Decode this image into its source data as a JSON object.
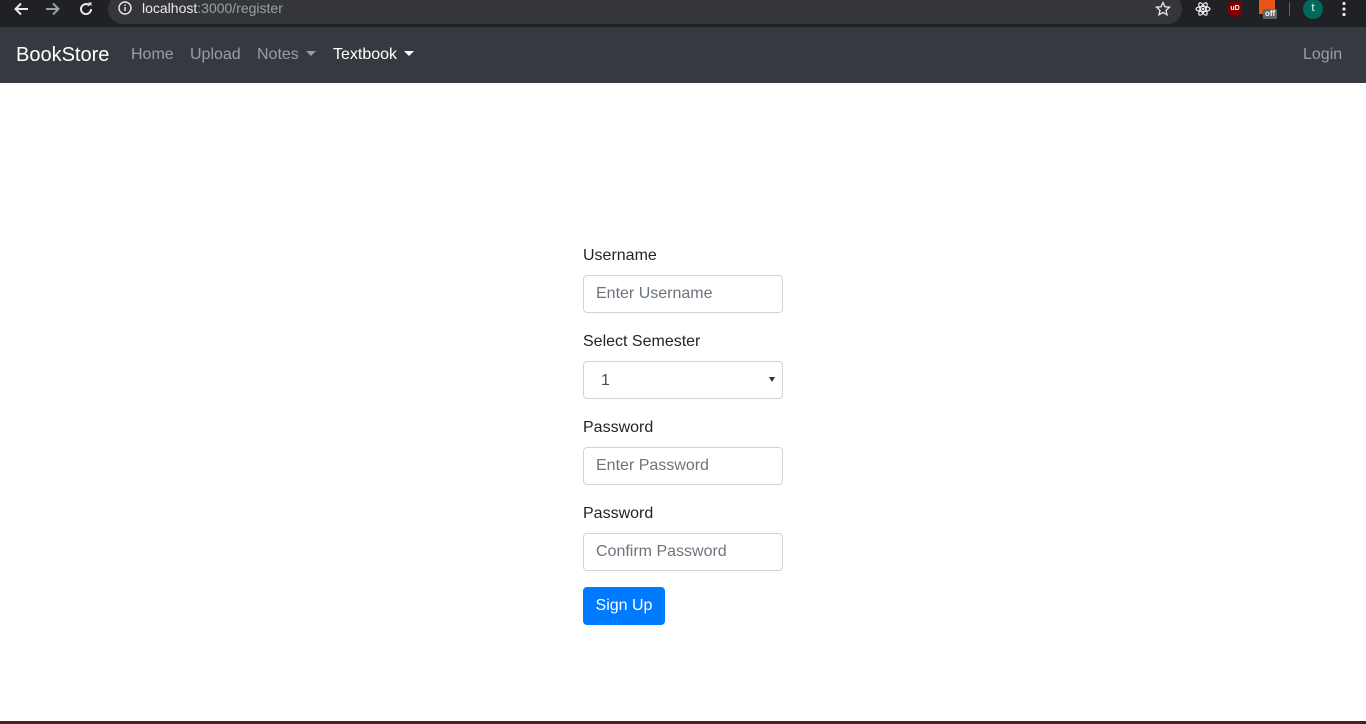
{
  "browser": {
    "url_host": "localhost",
    "url_path": ":3000/register",
    "icons": [
      "back-arrow-icon",
      "forward-arrow-icon",
      "reload-icon",
      "info-icon",
      "star-icon",
      "react-devtools-icon",
      "ublock-icon",
      "pdf-extension-icon",
      "profile-avatar",
      "menu-dots-icon"
    ],
    "ublock_label": "uD",
    "pdf_badge": "off",
    "profile_initial": "t"
  },
  "navbar": {
    "brand": "BookStore",
    "links": [
      {
        "label": "Home"
      },
      {
        "label": "Upload"
      },
      {
        "label": "Notes"
      },
      {
        "label": "Textbook"
      }
    ],
    "login": "Login"
  },
  "form": {
    "username_label": "Username",
    "username_placeholder": "Enter Username",
    "semester_label": "Select Semester",
    "semester_value": "1",
    "password_label": "Password",
    "password_placeholder": "Enter Password",
    "confirm_label": "Password",
    "confirm_placeholder": "Confirm Password",
    "submit_label": "Sign Up"
  },
  "colors": {
    "navbar_bg": "#343a40",
    "primary": "#007bff",
    "chrome_bg": "#202124"
  }
}
